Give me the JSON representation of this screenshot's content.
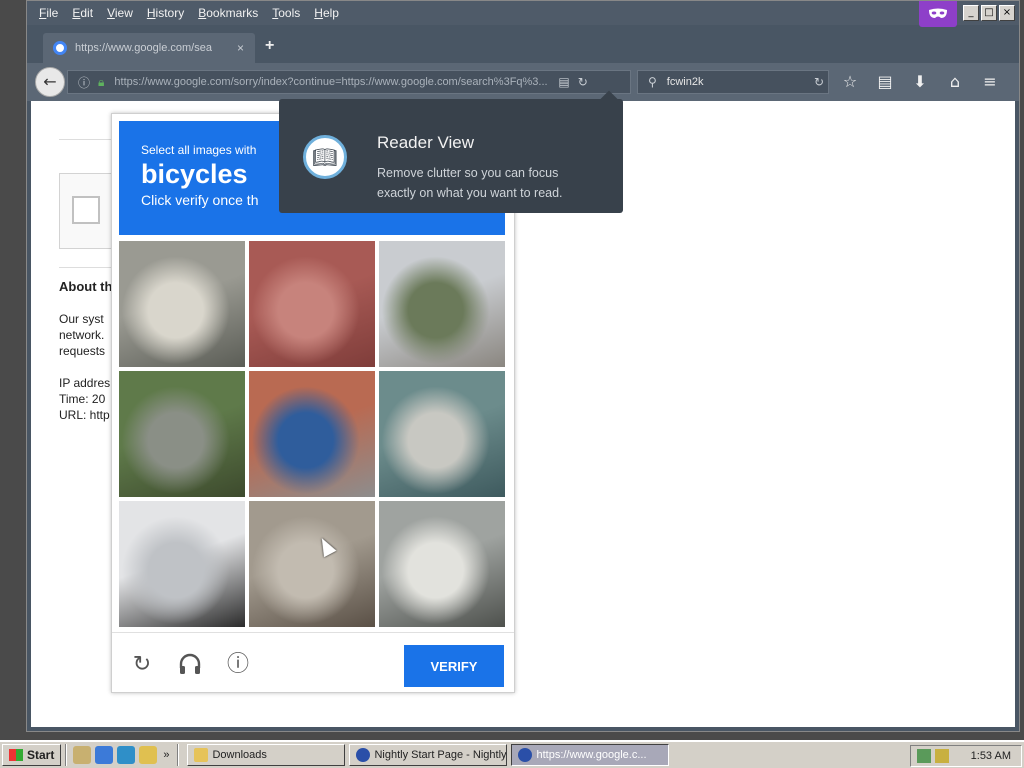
{
  "window": {
    "menus": [
      "File",
      "Edit",
      "View",
      "History",
      "Bookmarks",
      "Tools",
      "Help"
    ]
  },
  "tab": {
    "title": "https://www.google.com/sea",
    "close": "×",
    "new_tab": "+"
  },
  "nav": {
    "url": "https://www.google.com/sorry/index?continue=https://www.google.com/search%3Fq%3...",
    "search_value": "fcwin2k"
  },
  "page": {
    "about_title": "About th",
    "paragraph_lines": [
      "Our syst",
      "network.",
      "requests"
    ],
    "info_lines": [
      "IP addres",
      "Time: 20",
      "URL: http"
    ]
  },
  "captcha": {
    "instruction": "Select all images with",
    "object": "bicycles",
    "subtext": "Click verify once th",
    "verify_label": "VERIFY",
    "tiles": [
      {
        "subject": "car",
        "colors": [
          "#9a9a92",
          "#d9d6cc",
          "#5b5d56"
        ]
      },
      {
        "subject": "bicycle",
        "colors": [
          "#a85a55",
          "#c7837c",
          "#7f3d3a"
        ]
      },
      {
        "subject": "house-tree",
        "colors": [
          "#c9ccd0",
          "#6b7a5a",
          "#8a8680"
        ]
      },
      {
        "subject": "road-forest",
        "colors": [
          "#5f7a4a",
          "#8a8f86",
          "#3d4a2d"
        ]
      },
      {
        "subject": "bus",
        "colors": [
          "#b96a52",
          "#2f5d9c",
          "#8d8d8d"
        ]
      },
      {
        "subject": "blurry",
        "colors": [
          "#6c8c8c",
          "#c8c8c2",
          "#3e5a5e"
        ]
      },
      {
        "subject": "cyclist",
        "colors": [
          "#e3e4e6",
          "#bfc2c6",
          "#2b2b2b"
        ]
      },
      {
        "subject": "bicycle-person",
        "colors": [
          "#a29a8e",
          "#c2bbb0",
          "#5a5046"
        ]
      },
      {
        "subject": "van",
        "colors": [
          "#9fa3a0",
          "#e2e2dd",
          "#4e514d"
        ]
      }
    ]
  },
  "reader_popup": {
    "title": "Reader View",
    "description": "Remove clutter so you can focus exactly on what you want to read."
  },
  "taskbar": {
    "start_label": "Start",
    "tasks": [
      "Downloads",
      "Nightly Start Page - Nightly",
      "https://www.google.c..."
    ],
    "clock": "1:53 AM"
  },
  "colors": {
    "accent": "#1a73e8",
    "private_badge": "#8e3fc9",
    "reader_popup_bg": "#38414b"
  }
}
